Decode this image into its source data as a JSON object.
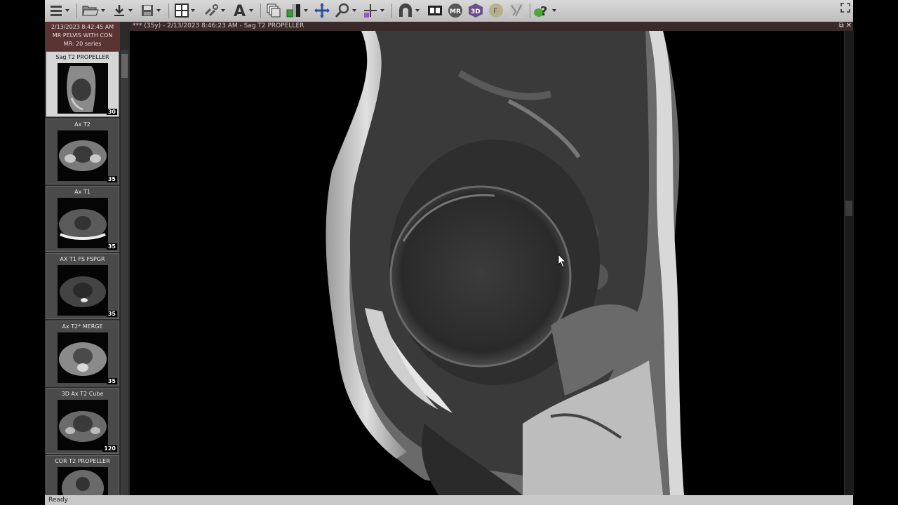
{
  "toolbar": {
    "icons": [
      "menu-icon",
      "folder-open-icon",
      "download-icon",
      "save-icon",
      "layout-grid-icon",
      "link-icon",
      "text-annotation-icon",
      "stack-icon",
      "window-level-icon",
      "pan-icon",
      "zoom-icon",
      "crosshair-icon",
      "arch-tool-icon",
      "cine-icon",
      "mpr-icon",
      "3d-icon",
      "fusion-icon",
      "measure-icon",
      "help-icon",
      "maximize-icon"
    ]
  },
  "study": {
    "date": "2/13/2023 8:42:45 AM",
    "description": "MR PELVIS WITH CON",
    "series_summary": "MR: 20 series"
  },
  "series": [
    {
      "label": "Sag T2 PROPELLER",
      "count": "30",
      "active": true
    },
    {
      "label": "Ax T2",
      "count": "35"
    },
    {
      "label": "Ax T1",
      "count": "35"
    },
    {
      "label": "AX T1 FS FSPGR",
      "count": "35"
    },
    {
      "label": "Ax T2* MERGE",
      "count": "35"
    },
    {
      "label": "3D Ax T2 Cube",
      "count": "120"
    },
    {
      "label": "COR T2 PROPELLER",
      "count": ""
    }
  ],
  "viewer": {
    "title": "*** (35y) - 2/13/2023 8:46:23 AM - Sag T2 PROPELLER",
    "ctrl_restore": "⧉",
    "ctrl_close": "✕"
  },
  "status": {
    "text": "Ready"
  }
}
